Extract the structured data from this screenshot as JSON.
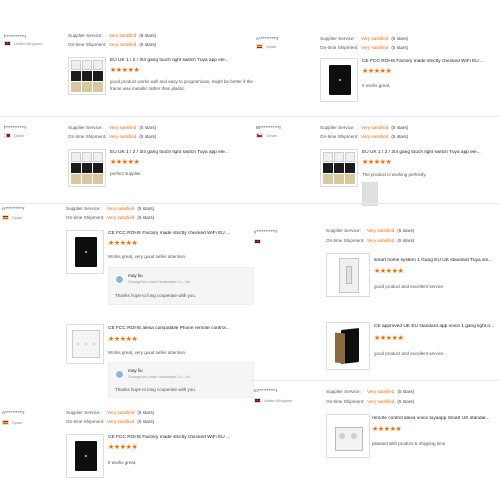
{
  "labels": {
    "supplier_service": "Supplier Service:",
    "on_time_shipment": "On-time Shipment:",
    "very_satisfied": "Very satisfied",
    "five_stars": "(5 stars)",
    "stars": "★★★★★"
  },
  "reviews": [
    {
      "buyer": "l***********r",
      "country": "United Kingdom",
      "title": "EU UK 1 / 2 / 3/4 gang touch light switch Tuya app ele...",
      "text1": "good product works well and easy to program/use, might be better if the",
      "text2": "frame was metallic rather than plastic."
    },
    {
      "buyer": "A**********r",
      "country": "Spain",
      "title": "CE FCC ROHS Factory made strictly checked WiFi EU ...",
      "text1": "It works great,"
    },
    {
      "buyer": "f***********r",
      "country": "Qatar",
      "title": "EU UK 1 / 2 / 3/4 gang touch light switch Tuya app ele...",
      "text1": "perfect supplier"
    },
    {
      "buyer": "M***********r",
      "country": "Oman",
      "title": "EU UK 1 / 2 / 3/4 gang touch light switch Tuya app ele...",
      "text1": "The product is working perfectly."
    },
    {
      "buyer": "A**********r",
      "country": "Spain",
      "title": "CE FCC ROHS Factory made strictly checked WiFi EU ...",
      "text1": "Works great, very good seller attention.",
      "reply": {
        "name": "may liu",
        "company": "Guangzhou Lewei Houseware Co., Ltd.",
        "text": "Thanks hope to long cooperate with you."
      }
    },
    {
      "buyer": "y***********r",
      "country": "",
      "title": "smart home system 1 Gang EU UK standard Tuya sm...",
      "text1": "good product and excellent service"
    },
    {
      "buyer": "",
      "country": "",
      "title": "CE FCC ROHS alexa compatible Phone remote control...",
      "text1": "Works great, very good seller attention.",
      "reply": {
        "name": "may liu",
        "company": "Guangzhou Lewei Houseware Co., Ltd.",
        "text": "Thanks hope to long cooperate with you."
      }
    },
    {
      "buyer": "",
      "country": "",
      "title": "CE approved UK EU standard app voice 1 gang light o...",
      "text1": "good product and excellent service"
    },
    {
      "buyer": "m**********r",
      "country": "United Kingdom",
      "title": "remote control alexa voice tuyaapp Smart UK standar...",
      "text1": "pleased with product & shipping time"
    },
    {
      "buyer": "A**********r",
      "country": "Spain",
      "title": "CE FCC ROHS Factory made strictly checked WiFi EU ...",
      "text1": "It works great,"
    }
  ]
}
